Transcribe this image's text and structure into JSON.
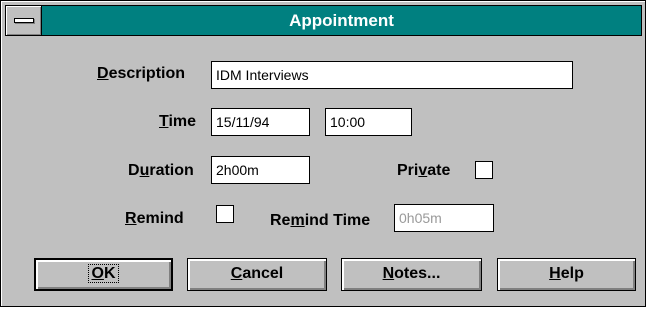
{
  "window": {
    "title": "Appointment"
  },
  "form": {
    "description": {
      "label_prefix": "",
      "label_mnemonic": "D",
      "label_suffix": "escription",
      "value": "IDM Interviews"
    },
    "time": {
      "label_prefix": "",
      "label_mnemonic": "T",
      "label_suffix": "ime",
      "date_value": "15/11/94",
      "time_value": "10:00"
    },
    "duration": {
      "label_prefix": "D",
      "label_mnemonic": "u",
      "label_suffix": "ration",
      "value": "2h00m"
    },
    "private": {
      "label_prefix": "Pri",
      "label_mnemonic": "v",
      "label_suffix": "ate",
      "checked": false
    },
    "remind": {
      "label_prefix": "",
      "label_mnemonic": "R",
      "label_suffix": "emind",
      "checked": false
    },
    "remind_time": {
      "label_prefix": "Re",
      "label_mnemonic": "m",
      "label_suffix": "ind Time",
      "value": "0h05m",
      "disabled": true
    }
  },
  "buttons": {
    "ok": {
      "mnemonic": "O",
      "suffix": "K"
    },
    "cancel": {
      "mnemonic": "C",
      "suffix": "ancel"
    },
    "notes": {
      "mnemonic": "N",
      "suffix": "otes..."
    },
    "help": {
      "mnemonic": "H",
      "suffix": "elp"
    }
  },
  "colors": {
    "titlebar": "#008080",
    "face": "#c0c0c0",
    "disabled_text": "#9a9a9a"
  },
  "icons": {
    "system_menu": "system-menu-icon"
  }
}
